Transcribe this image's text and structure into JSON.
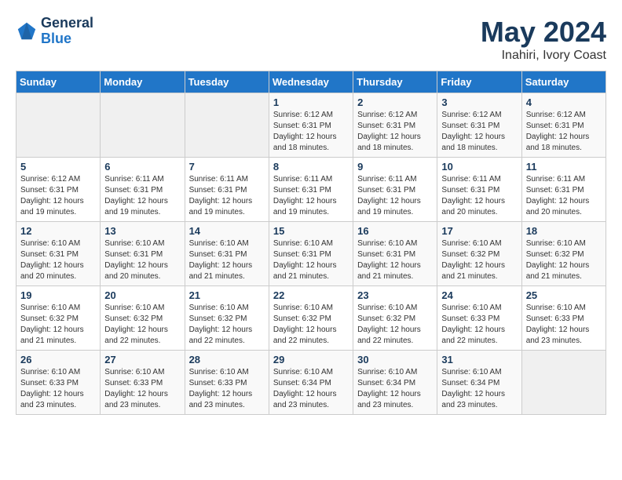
{
  "header": {
    "logo_line1": "General",
    "logo_line2": "Blue",
    "main_title": "May 2024",
    "subtitle": "Inahiri, Ivory Coast"
  },
  "weekdays": [
    "Sunday",
    "Monday",
    "Tuesday",
    "Wednesday",
    "Thursday",
    "Friday",
    "Saturday"
  ],
  "weeks": [
    [
      {
        "day": "",
        "info": ""
      },
      {
        "day": "",
        "info": ""
      },
      {
        "day": "",
        "info": ""
      },
      {
        "day": "1",
        "info": "Sunrise: 6:12 AM\nSunset: 6:31 PM\nDaylight: 12 hours and 18 minutes."
      },
      {
        "day": "2",
        "info": "Sunrise: 6:12 AM\nSunset: 6:31 PM\nDaylight: 12 hours and 18 minutes."
      },
      {
        "day": "3",
        "info": "Sunrise: 6:12 AM\nSunset: 6:31 PM\nDaylight: 12 hours and 18 minutes."
      },
      {
        "day": "4",
        "info": "Sunrise: 6:12 AM\nSunset: 6:31 PM\nDaylight: 12 hours and 18 minutes."
      }
    ],
    [
      {
        "day": "5",
        "info": "Sunrise: 6:12 AM\nSunset: 6:31 PM\nDaylight: 12 hours and 19 minutes."
      },
      {
        "day": "6",
        "info": "Sunrise: 6:11 AM\nSunset: 6:31 PM\nDaylight: 12 hours and 19 minutes."
      },
      {
        "day": "7",
        "info": "Sunrise: 6:11 AM\nSunset: 6:31 PM\nDaylight: 12 hours and 19 minutes."
      },
      {
        "day": "8",
        "info": "Sunrise: 6:11 AM\nSunset: 6:31 PM\nDaylight: 12 hours and 19 minutes."
      },
      {
        "day": "9",
        "info": "Sunrise: 6:11 AM\nSunset: 6:31 PM\nDaylight: 12 hours and 19 minutes."
      },
      {
        "day": "10",
        "info": "Sunrise: 6:11 AM\nSunset: 6:31 PM\nDaylight: 12 hours and 20 minutes."
      },
      {
        "day": "11",
        "info": "Sunrise: 6:11 AM\nSunset: 6:31 PM\nDaylight: 12 hours and 20 minutes."
      }
    ],
    [
      {
        "day": "12",
        "info": "Sunrise: 6:10 AM\nSunset: 6:31 PM\nDaylight: 12 hours and 20 minutes."
      },
      {
        "day": "13",
        "info": "Sunrise: 6:10 AM\nSunset: 6:31 PM\nDaylight: 12 hours and 20 minutes."
      },
      {
        "day": "14",
        "info": "Sunrise: 6:10 AM\nSunset: 6:31 PM\nDaylight: 12 hours and 21 minutes."
      },
      {
        "day": "15",
        "info": "Sunrise: 6:10 AM\nSunset: 6:31 PM\nDaylight: 12 hours and 21 minutes."
      },
      {
        "day": "16",
        "info": "Sunrise: 6:10 AM\nSunset: 6:31 PM\nDaylight: 12 hours and 21 minutes."
      },
      {
        "day": "17",
        "info": "Sunrise: 6:10 AM\nSunset: 6:32 PM\nDaylight: 12 hours and 21 minutes."
      },
      {
        "day": "18",
        "info": "Sunrise: 6:10 AM\nSunset: 6:32 PM\nDaylight: 12 hours and 21 minutes."
      }
    ],
    [
      {
        "day": "19",
        "info": "Sunrise: 6:10 AM\nSunset: 6:32 PM\nDaylight: 12 hours and 21 minutes."
      },
      {
        "day": "20",
        "info": "Sunrise: 6:10 AM\nSunset: 6:32 PM\nDaylight: 12 hours and 22 minutes."
      },
      {
        "day": "21",
        "info": "Sunrise: 6:10 AM\nSunset: 6:32 PM\nDaylight: 12 hours and 22 minutes."
      },
      {
        "day": "22",
        "info": "Sunrise: 6:10 AM\nSunset: 6:32 PM\nDaylight: 12 hours and 22 minutes."
      },
      {
        "day": "23",
        "info": "Sunrise: 6:10 AM\nSunset: 6:32 PM\nDaylight: 12 hours and 22 minutes."
      },
      {
        "day": "24",
        "info": "Sunrise: 6:10 AM\nSunset: 6:33 PM\nDaylight: 12 hours and 22 minutes."
      },
      {
        "day": "25",
        "info": "Sunrise: 6:10 AM\nSunset: 6:33 PM\nDaylight: 12 hours and 23 minutes."
      }
    ],
    [
      {
        "day": "26",
        "info": "Sunrise: 6:10 AM\nSunset: 6:33 PM\nDaylight: 12 hours and 23 minutes."
      },
      {
        "day": "27",
        "info": "Sunrise: 6:10 AM\nSunset: 6:33 PM\nDaylight: 12 hours and 23 minutes."
      },
      {
        "day": "28",
        "info": "Sunrise: 6:10 AM\nSunset: 6:33 PM\nDaylight: 12 hours and 23 minutes."
      },
      {
        "day": "29",
        "info": "Sunrise: 6:10 AM\nSunset: 6:34 PM\nDaylight: 12 hours and 23 minutes."
      },
      {
        "day": "30",
        "info": "Sunrise: 6:10 AM\nSunset: 6:34 PM\nDaylight: 12 hours and 23 minutes."
      },
      {
        "day": "31",
        "info": "Sunrise: 6:10 AM\nSunset: 6:34 PM\nDaylight: 12 hours and 23 minutes."
      },
      {
        "day": "",
        "info": ""
      }
    ]
  ]
}
